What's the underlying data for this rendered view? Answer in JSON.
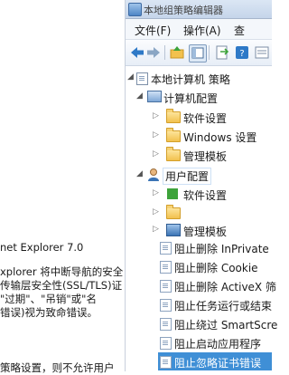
{
  "window": {
    "title": "本地组策略编辑器"
  },
  "menu": {
    "file": "文件(F)",
    "action": "操作(A)",
    "view": "查"
  },
  "tree": {
    "root": "本地计算机 策略",
    "computer_config": "计算机配置",
    "cc_children": [
      "软件设置",
      "Windows 设置",
      "管理模板"
    ],
    "user_config": "用户配置",
    "uc_children": [
      "软件设置",
      "",
      "管理模板"
    ]
  },
  "policies": [
    "阻止删除 InPrivate",
    "阻止删除 Cookie",
    "阻止删除 ActiveX 筛",
    "阻止任务运行或结束",
    "阻止绕过 SmartScre",
    "阻止启动应用程序",
    "阻止忽略证书错误"
  ],
  "help": {
    "lines": [
      "net Explorer 7.0",
      "",
      "xplorer 将中断导航的安全",
      "传输层安全性(SSL/TLS)证",
      "\"过期\"、\"吊销\"或\"名",
      "错误)视为致命错误。",
      "",
      "",
      "策略设置，则不允许用户"
    ]
  },
  "colors": {
    "selection": "#3f8fd6",
    "titlebar": "#c5d5ea"
  }
}
